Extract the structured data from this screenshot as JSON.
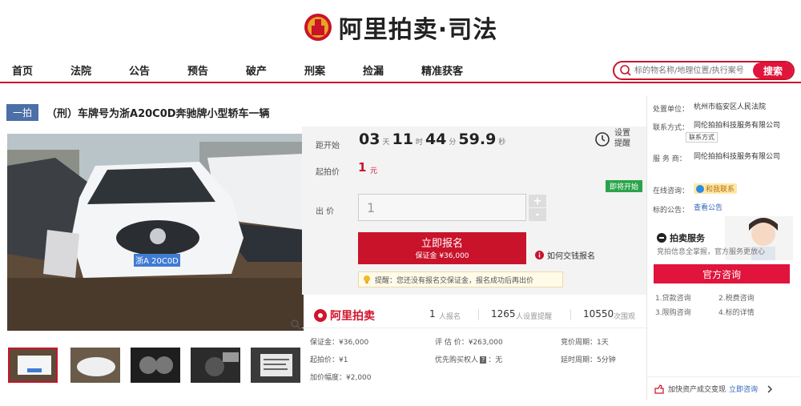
{
  "brand": {
    "logo_text": "阿里拍卖·司法"
  },
  "nav": {
    "items": [
      "首页",
      "法院",
      "公告",
      "预告",
      "破产",
      "刑案",
      "捡漏",
      "精准获客"
    ]
  },
  "search": {
    "placeholder": "标的物名称/地理位置/执行案号",
    "button": "搜索"
  },
  "item": {
    "badge": "一拍",
    "title": "（刑）车牌号为浙A20C0D奔驰牌小型轿车一辆",
    "plate": "浙A 20C0D"
  },
  "auction": {
    "countdown_label": "距开始",
    "days": "03",
    "days_unit": "天",
    "hours": "11",
    "hours_unit": "时",
    "minutes": "44",
    "minutes_unit": "分",
    "seconds": "59.9",
    "seconds_unit": "秒",
    "remind_label": "设置提醒",
    "start_price_label": "起拍价",
    "start_price": "1",
    "start_price_unit": "元",
    "soon_badge": "即将开始",
    "bid_label": "出 价",
    "bid_value": "1",
    "plus": "+",
    "minus": "-",
    "signup_button": "立即报名",
    "signup_deposit": "保证金 ¥36,000",
    "howto": "如何交钱报名",
    "tip": "提醒：您还没有报名交保证金，报名成功后再出价"
  },
  "stats": {
    "brand": "阿里拍卖",
    "signups": "1",
    "signups_unit": "人报名",
    "reminders": "1265",
    "reminders_unit": "人设置提醒",
    "views": "10550",
    "views_unit": "次围观"
  },
  "details": {
    "deposit": "保证金：¥36,000",
    "start_price": "起拍价：¥1",
    "increment": "加价幅度：¥2,000",
    "appraisal": "评 估 价：¥263,000",
    "priority_label": "优先购买权人",
    "priority_value": "：无",
    "bid_period": "竞价周期：1天",
    "delay_period": "延时周期：5分钟"
  },
  "side": {
    "org_label": "处置单位：",
    "org_value": "杭州市临安区人民法院",
    "contact_label": "联系方式：",
    "contact_value": "同伦拍拍科技服务有限公司",
    "contact_tag": "联系方式",
    "service_label": "服 务 商：",
    "service_value": "同伦拍拍科技服务有限公司",
    "consult_label": "在线咨询：",
    "consult_tag": "和我联系",
    "notice_label": "标的公告：",
    "notice_link": "查看公告",
    "svc_title": "拍卖服务",
    "svc_desc": "竞拍信息全掌握，官方服务更放心",
    "official_button": "官方咨询",
    "links": [
      "1.贷款咨询",
      "2.税费咨询",
      "3.限购咨询",
      "4.标的详情"
    ],
    "bottom_text": "加快资产成交变现",
    "bottom_link": "立即咨询"
  },
  "colors": {
    "accent": "#c9132b",
    "badge": "#4b6fa6",
    "green": "#2aa44a"
  }
}
